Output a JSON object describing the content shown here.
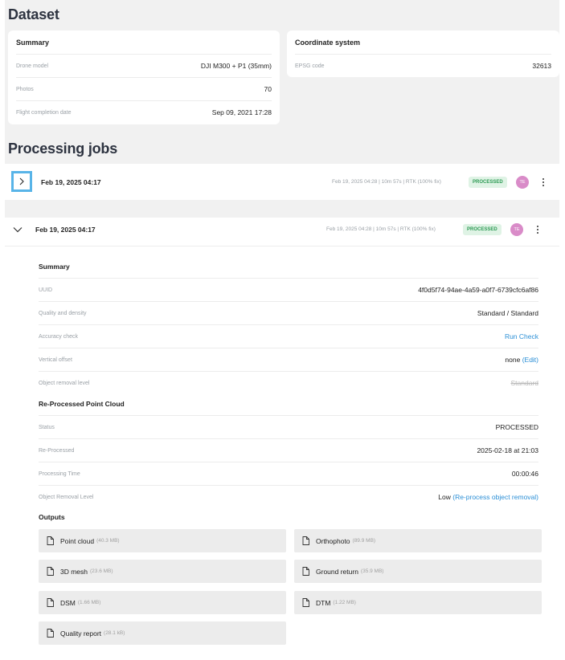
{
  "dataset": {
    "heading": "Dataset",
    "summary": {
      "title": "Summary",
      "rows": [
        {
          "label": "Drone model",
          "value": "DJI M300 + P1 (35mm)"
        },
        {
          "label": "Photos",
          "value": "70"
        },
        {
          "label": "Flight completion date",
          "value": "Sep 09, 2021 17:28"
        }
      ]
    },
    "coordinate": {
      "title": "Coordinate system",
      "rows": [
        {
          "label": "EPSG code",
          "value": "32613"
        }
      ]
    }
  },
  "processing": {
    "heading": "Processing jobs",
    "job1": {
      "title": "Feb 19, 2025 04:17",
      "meta": "Feb 19, 2025 04:28 | 10m 57s | RTK (100% fix)",
      "status": "PROCESSED",
      "avatar": "TE"
    },
    "job2": {
      "title": "Feb 19, 2025 04:17",
      "meta": "Feb 19, 2025 04:28 | 10m 57s | RTK (100% fix)",
      "status": "PROCESSED",
      "avatar": "TE",
      "summary_title": "Summary",
      "summary": [
        {
          "label": "UUID",
          "value": "4f0d5f74-94ae-4a59-a0f7-6739cfc6af86"
        },
        {
          "label": "Quality and density",
          "value": "Standard / Standard"
        },
        {
          "label": "Accuracy check",
          "value": "Run Check"
        },
        {
          "label": "Vertical offset",
          "value": "none",
          "link": "(Edit)"
        },
        {
          "label": "Object removal level",
          "value": "Standard"
        }
      ],
      "reprocessed_title": "Re-Processed Point Cloud",
      "reprocessed": [
        {
          "label": "Status",
          "value": "PROCESSED"
        },
        {
          "label": "Re-Processed",
          "value": "2025-02-18 at 21:03"
        },
        {
          "label": "Processing Time",
          "value": "00:00:46"
        },
        {
          "label": "Object Removal Level",
          "value": "Low",
          "link": "(Re-process object removal)"
        }
      ],
      "outputs_title": "Outputs",
      "outputs": [
        {
          "name": "Point cloud",
          "size": "(40.3 MB)"
        },
        {
          "name": "Orthophoto",
          "size": "(89.9 MB)"
        },
        {
          "name": "3D mesh",
          "size": "(23.6 MB)"
        },
        {
          "name": "Ground return",
          "size": "(35.9 MB)"
        },
        {
          "name": "DSM",
          "size": "(1.66 MB)"
        },
        {
          "name": "DTM",
          "size": "(1.22 MB)"
        },
        {
          "name": "Quality report",
          "size": "(28.1 kB)"
        }
      ]
    }
  },
  "icons": {
    "expand": "chevron-right-icon",
    "collapse": "chevron-down-icon",
    "file": "file-icon",
    "more": "kebab-menu-icon"
  },
  "colors": {
    "link": "#2b8fd6",
    "badge_bg": "#dff3e5",
    "badge_text": "#2e9b55",
    "avatar": "#d98bc8",
    "focus_ring": "#58b4e8"
  }
}
